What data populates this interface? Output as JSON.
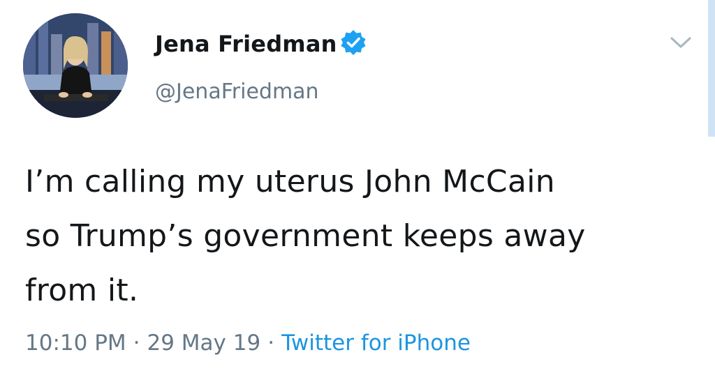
{
  "author": {
    "display_name": "Jena Friedman",
    "handle": "@JenaFriedman",
    "verified_icon": "verified-badge-icon"
  },
  "menu": {
    "icon": "chevron-down-icon"
  },
  "tweet": {
    "lines": [
      "I’m calling my uterus John McCain",
      "so Trump’s government keeps away",
      "from it."
    ]
  },
  "meta": {
    "time": "10:10 PM",
    "separator": "·",
    "date": "29 May 19",
    "source": "Twitter for iPhone"
  },
  "colors": {
    "text": "#14171a",
    "secondary": "#657786",
    "link": "#1b95e0",
    "verified": "#1da1f2"
  }
}
